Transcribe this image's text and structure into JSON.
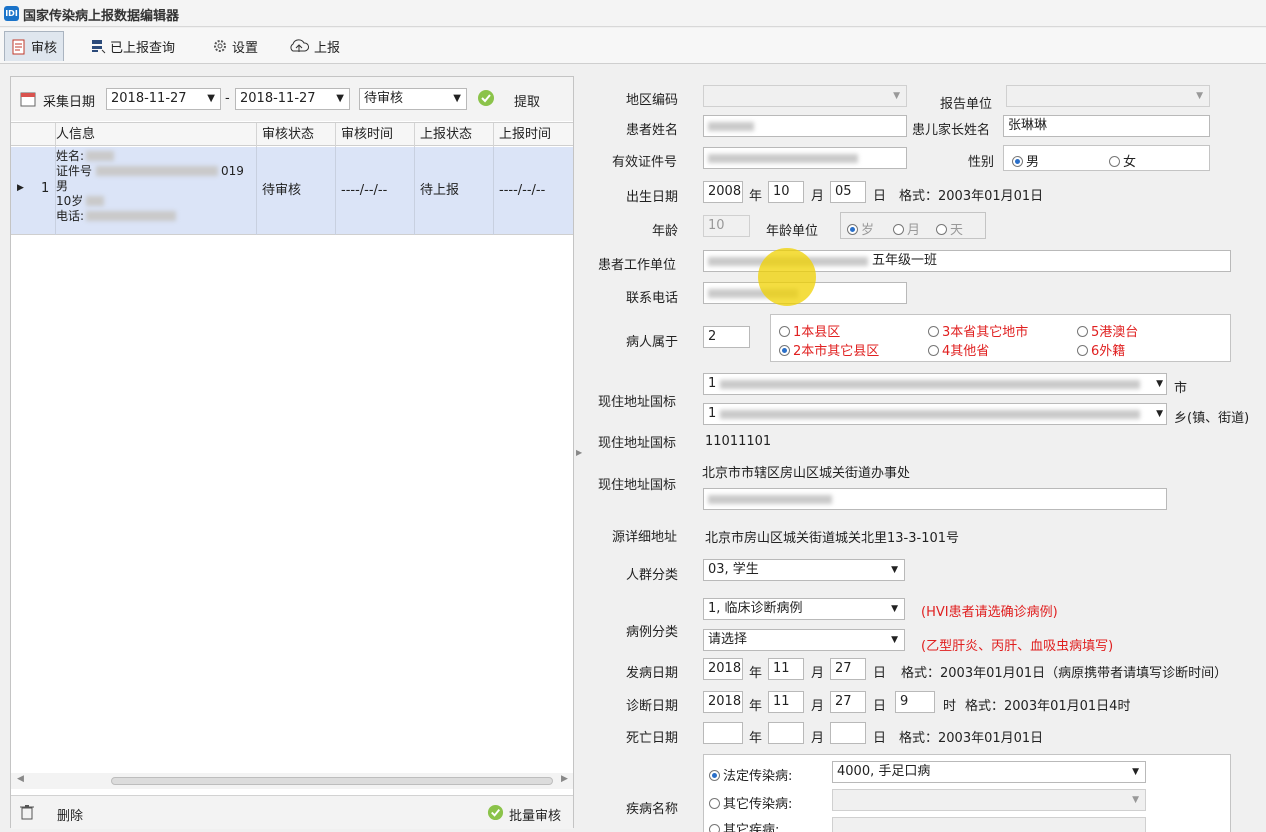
{
  "app": {
    "title": "国家传染病上报数据编辑器",
    "icon_text": "IDI"
  },
  "toolbar": {
    "review": "审核",
    "reported_query": "已上报查询",
    "settings": "设置",
    "upload": "上报"
  },
  "filter": {
    "date_label": "采集日期",
    "date_from": "2018-11-27",
    "date_sep": "-",
    "date_to": "2018-11-27",
    "status": "待审核",
    "fetch": "提取"
  },
  "grid": {
    "headers": [
      "人信息",
      "审核状态",
      "审核时间",
      "上报状态",
      "上报时间"
    ],
    "row": {
      "index": "1",
      "info": [
        "姓名:",
        "证件号",
        "男",
        "10岁",
        "电话:"
      ],
      "id_tail": "019",
      "review_status": "待审核",
      "review_time": "----/--/--",
      "report_status": "待上报",
      "report_time": "----/--/--"
    }
  },
  "bottom": {
    "delete": "删除",
    "batch_review": "批量审核"
  },
  "form": {
    "region_code": "地区编码",
    "report_unit": "报告单位",
    "patient_name": "患者姓名",
    "parent_name_label": "患儿家长姓名",
    "parent_name": "张琳琳",
    "id_number": "有效证件号",
    "gender_label": "性别",
    "male": "男",
    "female": "女",
    "birth_label": "出生日期",
    "birth_year": "2008",
    "birth_month": "10",
    "birth_day": "05",
    "year_u": "年",
    "month_u": "月",
    "day_u": "日",
    "format_hint": "格式：2003年01月01日",
    "age_label": "年龄",
    "age": "10",
    "age_unit_label": "年龄单位",
    "age_sui": "岁",
    "age_yue": "月",
    "age_tian": "天",
    "work_label": "患者工作单位",
    "work_value": "五年级一班",
    "phone_label": "联系电话",
    "belong_label": "病人属于",
    "belong_value": "2",
    "belong_opts": [
      "1本县区",
      "2本市其它县区",
      "3本省其它地市",
      "4其他省",
      "5港澳台",
      "6外籍"
    ],
    "addr_label": "现住地址国标",
    "city_u": "市",
    "town_u": "乡(镇、街道)",
    "addr_prefix": "1",
    "addr_code": "11011101",
    "addr_text": "北京市市辖区房山区城关街道办事处",
    "detail_addr_label": "源详细地址",
    "detail_addr": "北京市房山区城关街道城关北里13-3-101号",
    "crowd_label": "人群分类",
    "crowd_value": "03, 学生",
    "case_label": "病例分类",
    "case_value1": "1, 临床诊断病例",
    "case_hint1": "(HVI患者请选确诊病例)",
    "case_value2": "请选择",
    "case_hint2": "(乙型肝炎、丙肝、血吸虫病填写)",
    "onset_label": "发病日期",
    "onset_year": "2018",
    "onset_month": "11",
    "onset_day": "27",
    "onset_hint": "格式：2003年01月01日（病原携带者请填写诊断时间）",
    "diag_label": "诊断日期",
    "diag_year": "2018",
    "diag_month": "11",
    "diag_day": "27",
    "diag_hour": "9",
    "hour_u": "时",
    "diag_hint": "格式：2003年01月01日4时",
    "death_label": "死亡日期",
    "death_hint": "格式：2003年01月01日",
    "disease_label": "疾病名称",
    "legal": "法定传染病:",
    "legal_value": "4000, 手足口病",
    "other_inf": "其它传染病:",
    "other_dis": "其它疾病:"
  },
  "colors": {
    "selected_row": "#dbe4f7",
    "red_text": "#e02020",
    "accent": "#2a6fc9"
  }
}
